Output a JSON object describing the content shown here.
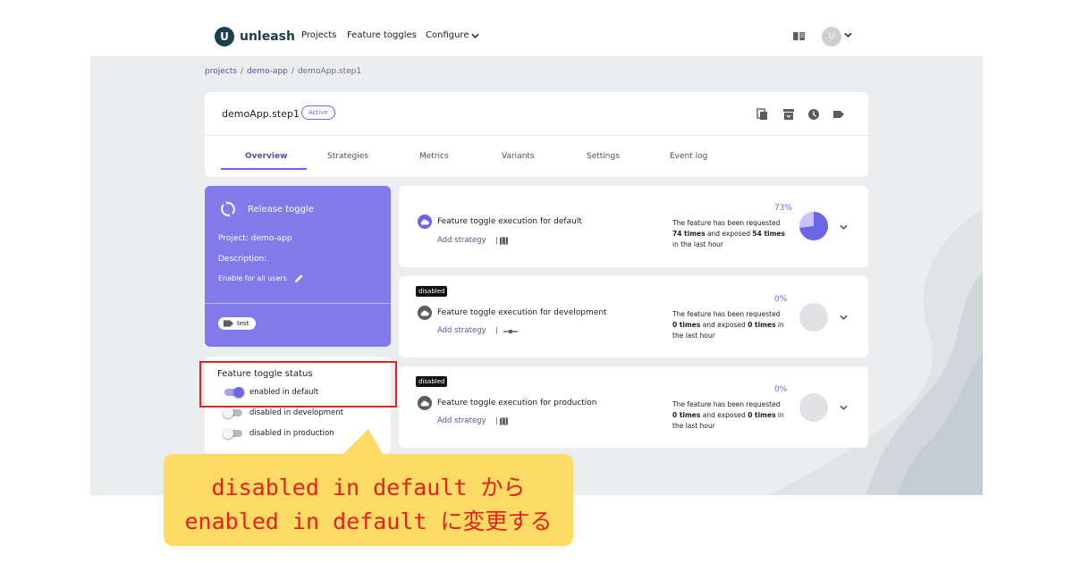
{
  "nav": {
    "logo": "unleash",
    "logo_mark": "U",
    "projects": "Projects",
    "feature_toggles": "Feature toggles",
    "configure": "Configure",
    "avatar": "U"
  },
  "breadcrumb": {
    "projects": "projects",
    "sep1": "/",
    "project": "demo-app",
    "sep2": "/",
    "current": "demoApp.step1"
  },
  "feature": {
    "name": "demoApp.step1",
    "status_badge": "Active",
    "icons": [
      "copy-icon",
      "archive-icon",
      "history-icon",
      "tag-icon"
    ]
  },
  "tabs": [
    "Overview",
    "Strategies",
    "Metrics",
    "Variants",
    "Settings",
    "Event log"
  ],
  "info_card": {
    "type": "Release toggle",
    "project": "Project: demo-app",
    "description_label": "Description:",
    "description": "Enable for all users",
    "tag": "test"
  },
  "status_card": {
    "title": "Feature toggle status",
    "rows": [
      {
        "label": "enabled in default",
        "on": true
      },
      {
        "label": "disabled in development",
        "on": false
      },
      {
        "label": "disabled in production",
        "on": false
      }
    ]
  },
  "environments": [
    {
      "disabled_badge": "",
      "name": "Feature toggle execution for default",
      "add_strategy": "Add strategy",
      "sep": "|",
      "pct": "73%",
      "line1": "The feature has been requested",
      "requested": "74 times",
      "mid": " and exposed ",
      "exposed": "54 times",
      "line3": "in the last hour",
      "fraction": 0.73,
      "active": true
    },
    {
      "disabled_badge": "disabled",
      "name": "Feature toggle execution for development",
      "add_strategy": "Add strategy",
      "sep": "|",
      "pct": "0%",
      "line1": "The feature has been requested",
      "requested": "0 times",
      "mid": " and exposed ",
      "exposed": "0 times",
      "line3_pre": " in",
      "line3": "the last hour",
      "fraction": 0,
      "active": false
    },
    {
      "disabled_badge": "disabled",
      "name": "Feature toggle execution for production",
      "add_strategy": "Add strategy",
      "sep": "|",
      "pct": "0%",
      "line1": "The feature has been requested",
      "requested": "0 times",
      "mid": " and exposed ",
      "exposed": "0 times",
      "line3_pre": " in",
      "line3": "the last hour",
      "fraction": 0,
      "active": false
    }
  ],
  "callout": {
    "line1": "disabled in default から",
    "line2": "enabled in default に変更する"
  },
  "colors": {
    "accent": "#6c65e5",
    "purple_card": "#817aeb",
    "highlight_red": "#e8201d",
    "callout_yellow": "#fedb64"
  }
}
